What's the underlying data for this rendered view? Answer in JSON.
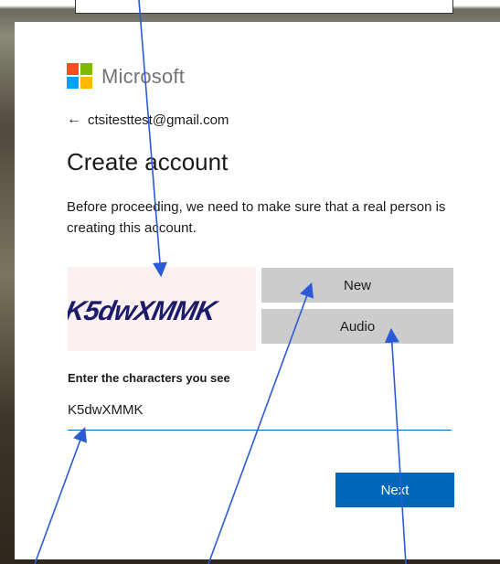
{
  "brand": {
    "name": "Microsoft"
  },
  "back": {
    "arrow": "←",
    "email": "ctsitesttest@gmail.com"
  },
  "title": "Create account",
  "description": "Before proceeding, we need to make sure that a real person is creating this account.",
  "captcha": {
    "text": "K5dwXMMK"
  },
  "buttons": {
    "new": "New",
    "audio": "Audio",
    "next": "Next"
  },
  "field": {
    "label": "Enter the characters you see",
    "value": "K5dwXMMK"
  },
  "colors": {
    "accent": "#0067b8",
    "annotation_arrow": "#2a5bd7"
  }
}
